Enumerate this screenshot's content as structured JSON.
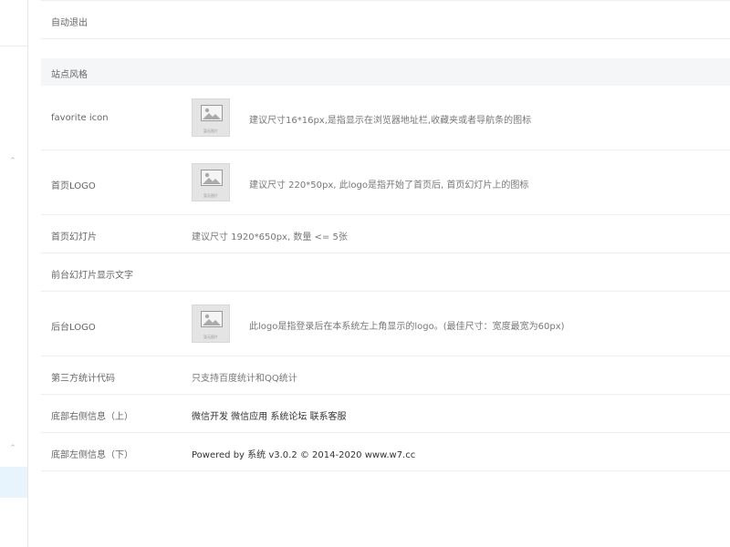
{
  "settings": {
    "auto_logout_label": "自动退出",
    "section_title": "站点风格",
    "favicon": {
      "label": "favorite icon",
      "hint": "建议尺寸16*16px,是指显示在浏览器地址栏,收藏夹或者导航条的图标"
    },
    "home_logo": {
      "label": "首页LOGO",
      "hint": "建议尺寸 220*50px, 此logo是指开始了首页后, 首页幻灯片上的图标"
    },
    "slides": {
      "label": "首页幻灯片",
      "value": "建议尺寸 1920*650px, 数量 <= 5张"
    },
    "slide_text": {
      "label": "前台幻灯片显示文字"
    },
    "admin_logo": {
      "label": "后台LOGO",
      "hint": "此logo是指登录后在本系统左上角显示的logo。(最佳尺寸：宽度最宽为60px)"
    },
    "stats": {
      "label": "第三方统计代码",
      "value": "只支持百度统计和QQ统计"
    },
    "footer_right": {
      "label": "底部右侧信息（上）",
      "value": "微信开发 微信应用 系统论坛 联系客服"
    },
    "footer_left": {
      "label": "底部左侧信息（下）",
      "value": "Powered by 系统 v3.0.2 © 2014-2020 www.w7.cc"
    }
  },
  "placeholder_caption": "暂无图片",
  "icons": [
    "chevron-up-icon",
    "image-placeholder-icon"
  ]
}
